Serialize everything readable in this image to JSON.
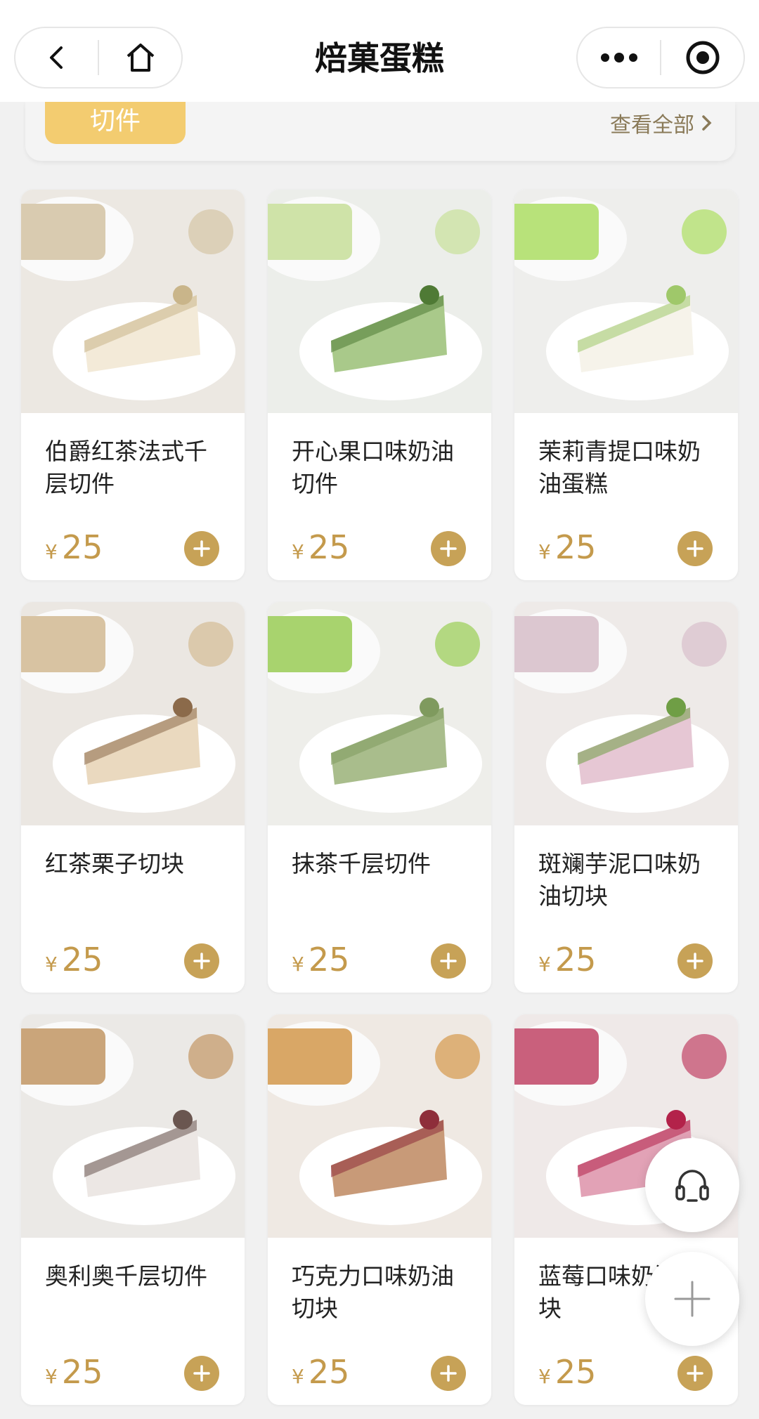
{
  "header": {
    "title": "焙菓蛋糕"
  },
  "category": {
    "tag": "切件",
    "view_all": "查看全部"
  },
  "currency": "¥",
  "products": [
    {
      "name": "伯爵红茶法式千层切件",
      "price": "25",
      "photo": {
        "bg": "#ece8e2",
        "cake": "#f3ead8",
        "accent": "#c9b58a",
        "side": "#d9cbb0"
      }
    },
    {
      "name": "开心果口味奶油切件",
      "price": "25",
      "photo": {
        "bg": "#eceeea",
        "cake": "#a9c98a",
        "accent": "#4f7a35",
        "side": "#cfe3a8"
      }
    },
    {
      "name": "茉莉青提口味奶油蛋糕",
      "price": "25",
      "photo": {
        "bg": "#eeeeec",
        "cake": "#f6f3ea",
        "accent": "#9fc86a",
        "side": "#b8e27a"
      }
    },
    {
      "name": "红茶栗子切块",
      "price": "25",
      "photo": {
        "bg": "#ebe7e2",
        "cake": "#ead9bf",
        "accent": "#8b6a4a",
        "side": "#d8c3a2"
      }
    },
    {
      "name": "抹茶千层切件",
      "price": "25",
      "photo": {
        "bg": "#eeeeea",
        "cake": "#a9bd8c",
        "accent": "#7f9a5e",
        "side": "#a8d36e"
      }
    },
    {
      "name": "斑斓芋泥口味奶油切块",
      "price": "25",
      "photo": {
        "bg": "#eeeae8",
        "cake": "#e6c7d4",
        "accent": "#6f9e45",
        "side": "#dcc7d0"
      }
    },
    {
      "name": "奥利奥千层切件",
      "price": "25",
      "photo": {
        "bg": "#ebe9e6",
        "cake": "#ece7e4",
        "accent": "#6a5650",
        "side": "#caa57a"
      }
    },
    {
      "name": "巧克力口味奶油切块",
      "price": "25",
      "photo": {
        "bg": "#efe9e3",
        "cake": "#c89a78",
        "accent": "#8e2e3a",
        "side": "#d9a766"
      }
    },
    {
      "name": "蓝莓口味奶油切块",
      "price": "25",
      "photo": {
        "bg": "#efe9e8",
        "cake": "#e2a2b6",
        "accent": "#b3224a",
        "side": "#c9607c"
      }
    }
  ],
  "colors": {
    "gold": "#c7a257",
    "tag": "#f3cc70",
    "price": "#c49a4c"
  },
  "icons": [
    "back-icon",
    "home-icon",
    "more-dots-icon",
    "target-icon",
    "chevron-right-icon",
    "plus-icon",
    "headset-icon"
  ]
}
